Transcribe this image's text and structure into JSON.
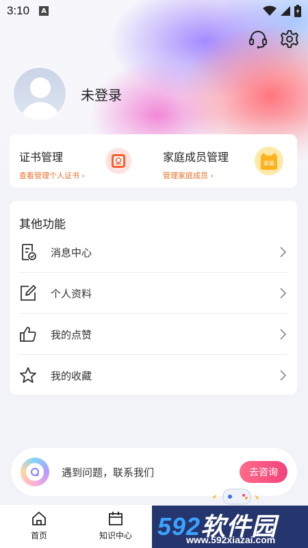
{
  "status_bar": {
    "time": "3:10",
    "notification_letter": "A"
  },
  "header": {
    "support_icon": "headset-icon",
    "settings_icon": "gear-icon"
  },
  "profile": {
    "login_status": "未登录"
  },
  "quick_cards": [
    {
      "title": "证书管理",
      "subtitle": "查看管理个人证书 ›",
      "icon": "certificate-icon"
    },
    {
      "title": "家庭成员管理",
      "subtitle": "管理家庭成员 ›",
      "icon": "family-icon",
      "icon_text": "家庭"
    }
  ],
  "other_functions": {
    "title": "其他功能",
    "items": [
      {
        "label": "消息中心",
        "icon": "message-center-icon"
      },
      {
        "label": "个人资料",
        "icon": "edit-profile-icon"
      },
      {
        "label": "我的点赞",
        "icon": "thumbs-up-icon"
      },
      {
        "label": "我的收藏",
        "icon": "star-icon"
      }
    ]
  },
  "consult": {
    "text": "遇到问题，联系我们",
    "button": "去咨询"
  },
  "tab_bar": {
    "tabs": [
      {
        "label": "首页",
        "icon": "home-icon"
      },
      {
        "label": "知识中心",
        "icon": "calendar-icon"
      }
    ]
  },
  "watermark": {
    "brand_number": "592",
    "brand_text": "软件园",
    "url": "www.592xiazai.com"
  },
  "colors": {
    "accent_orange": "#e8702a",
    "consult_button": "#f0437a",
    "background": "#f2f3f8",
    "watermark_bg": "#25356d"
  }
}
